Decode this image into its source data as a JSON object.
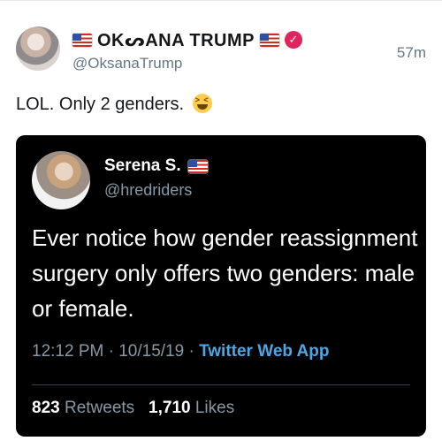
{
  "tweet": {
    "display_name": "OKᔕANA TRUMP",
    "handle": "@OksanaTrump",
    "time": "57m",
    "text": "LOL. Only 2 genders.",
    "emoji": "squinting-laughing-face"
  },
  "quoted": {
    "display_name": "Serena S.",
    "handle": "@hredriders",
    "text": "Ever notice how gender reassignment surgery only offers two genders: male or female.",
    "time": "12:12 PM",
    "date": "10/15/19",
    "source": "Twitter Web App",
    "retweets_count": "823",
    "retweets_label": "Retweets",
    "likes_count": "1,710",
    "likes_label": "Likes"
  },
  "colors": {
    "verified": "#e0245e",
    "card_bg": "#000000",
    "link": "#4aa8e8",
    "muted": "#657786"
  }
}
